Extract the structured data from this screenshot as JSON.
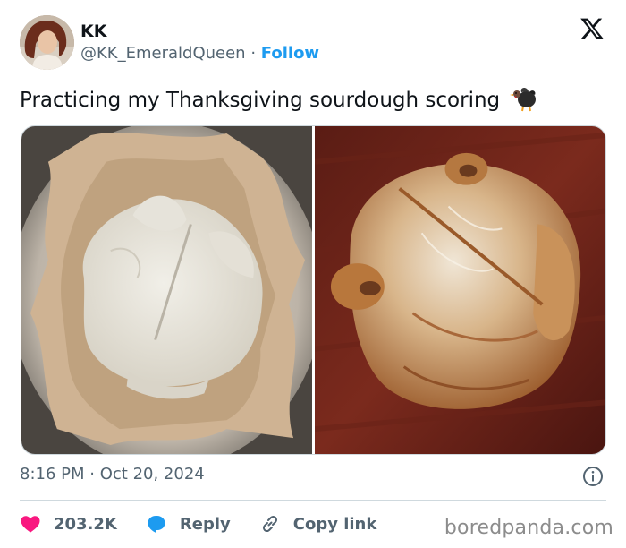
{
  "author": {
    "name": "KK",
    "handle": "@KK_EmeraldQueen",
    "separator": "·",
    "follow_label": "Follow"
  },
  "post": {
    "text": "Practicing my Thanksgiving sourdough scoring",
    "emoji_icon": "turkey-icon",
    "time": "8:16 PM",
    "date_separator": "·",
    "date": "Oct 20, 2024"
  },
  "media": [
    {
      "icon": "unbaked-dough-photo"
    },
    {
      "icon": "baked-bread-photo"
    }
  ],
  "actions": {
    "likes": "203.2K",
    "reply_label": "Reply",
    "copy_link_label": "Copy link"
  },
  "colors": {
    "like": "#f91880",
    "reply": "#1d9bf0",
    "follow": "#1d9bf0",
    "secondary_text": "#536471"
  },
  "watermark": "boredpanda.com"
}
